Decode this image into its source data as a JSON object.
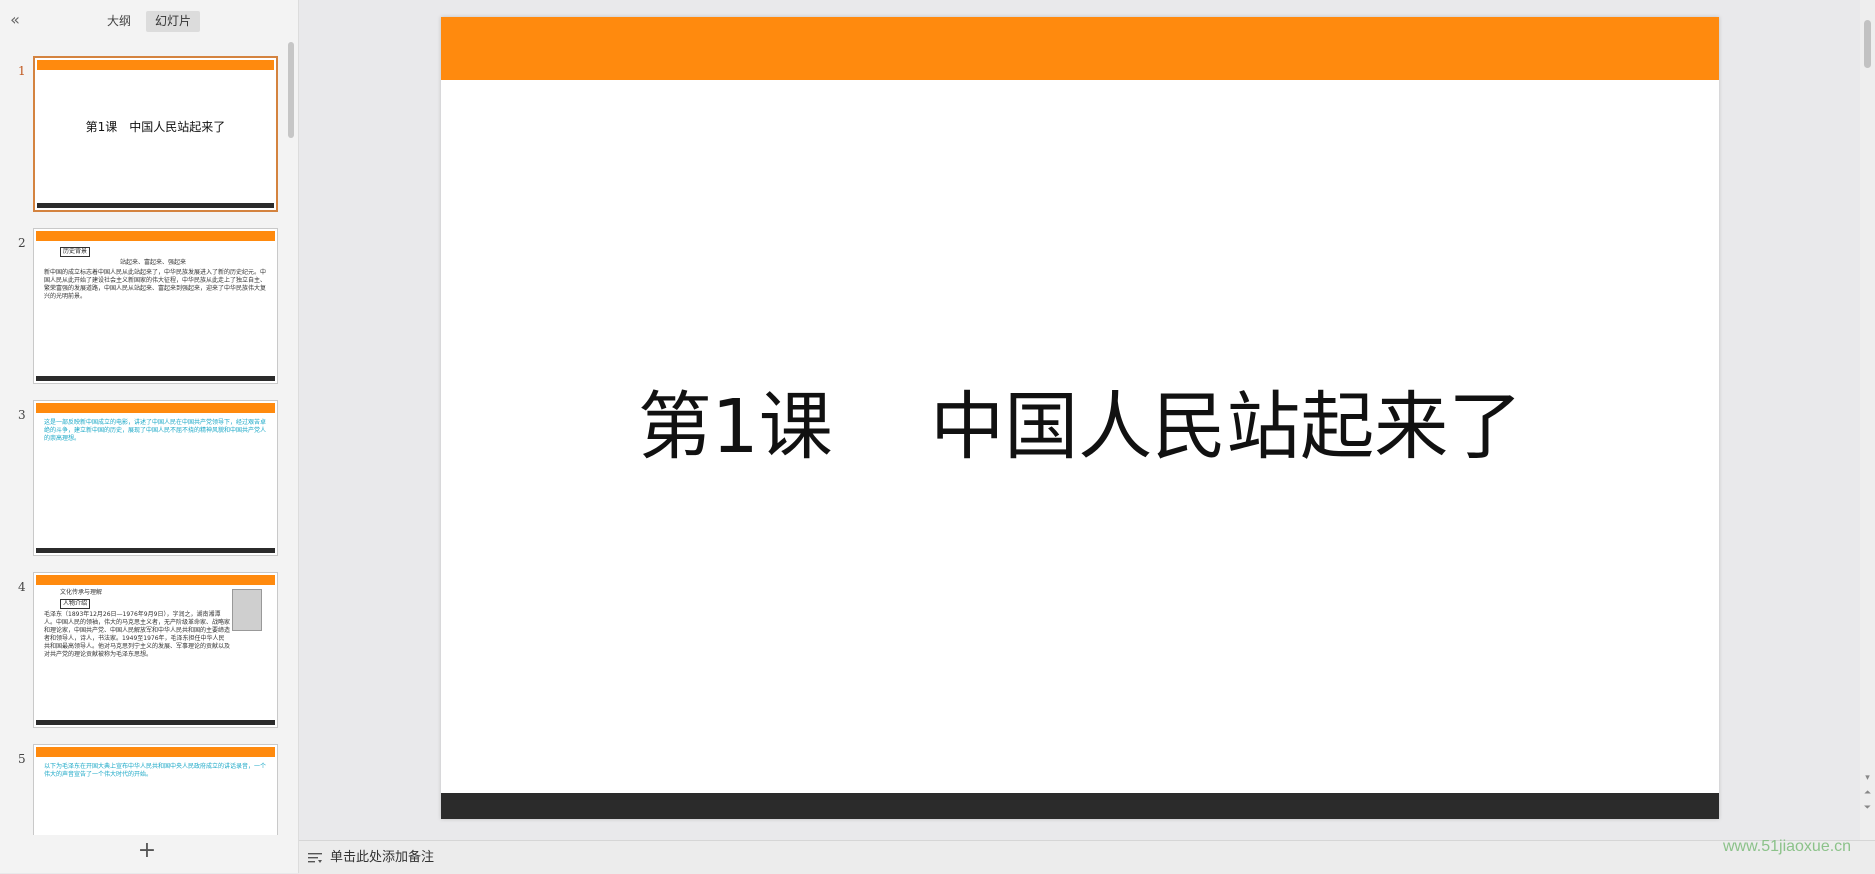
{
  "sidebar": {
    "collapse_icon": "«",
    "tabs": [
      {
        "label": "大纲"
      },
      {
        "label": "幻灯片"
      }
    ],
    "add_icon": "+",
    "thumbnails": [
      {
        "number": "1",
        "title": "第1课　中国人民站起来了"
      },
      {
        "number": "2",
        "box_label": "历史背景",
        "subtitle": "站起来、富起来、强起来",
        "text": "新中国的成立标志着中国人民从此站起来了，中华民族发展进入了新的历史纪元。中国人民从此开始了建设社会主义新国家的伟大征程，中华民族从此走上了独立自主、繁荣富强的发展道路，中国人民从站起来、富起来到强起来，迎来了中华民族伟大复兴的光明前景。"
      },
      {
        "number": "3",
        "text": "这是一部反映新中国成立的电影，讲述了中国人民在中国共产党领导下，经过艰苦卓绝的斗争，建立新中国的历史，展现了中国人民不屈不挠的精神风貌和中国共产党人的崇高理想。"
      },
      {
        "number": "4",
        "heading": "文化传承与理解",
        "box_label": "人物介绍",
        "text": "毛泽东（1893年12月26日—1976年9月9日），字润之，湖南湘潭人。中国人民的领袖，伟大的马克思主义者，无产阶级革命家、战略家和理论家，中国共产党、中国人民解放军和中华人民共和国的主要缔造者和领导人，诗人，书法家。1949至1976年，毛泽东担任中华人民共和国最高领导人。他对马克思列宁主义的发展、军事理论的贡献以及对共产党的理论贡献被称为毛泽东思想。"
      },
      {
        "number": "5",
        "text": "以下为毛泽东在开国大典上宣布中华人民共和国中央人民政府成立的讲话录音，一个伟大的声音宣告了一个伟大时代的开始。"
      }
    ]
  },
  "slide": {
    "title": "第1课　 中国人民站起来了"
  },
  "notes": {
    "placeholder": "单击此处添加备注"
  },
  "watermark": "www.51jiaoxue.cn",
  "colors": {
    "accent_orange": "#ff8a0e",
    "footer_dark": "#2b2b2b",
    "thumbnail_text_cyan": "#1aa8c7"
  }
}
